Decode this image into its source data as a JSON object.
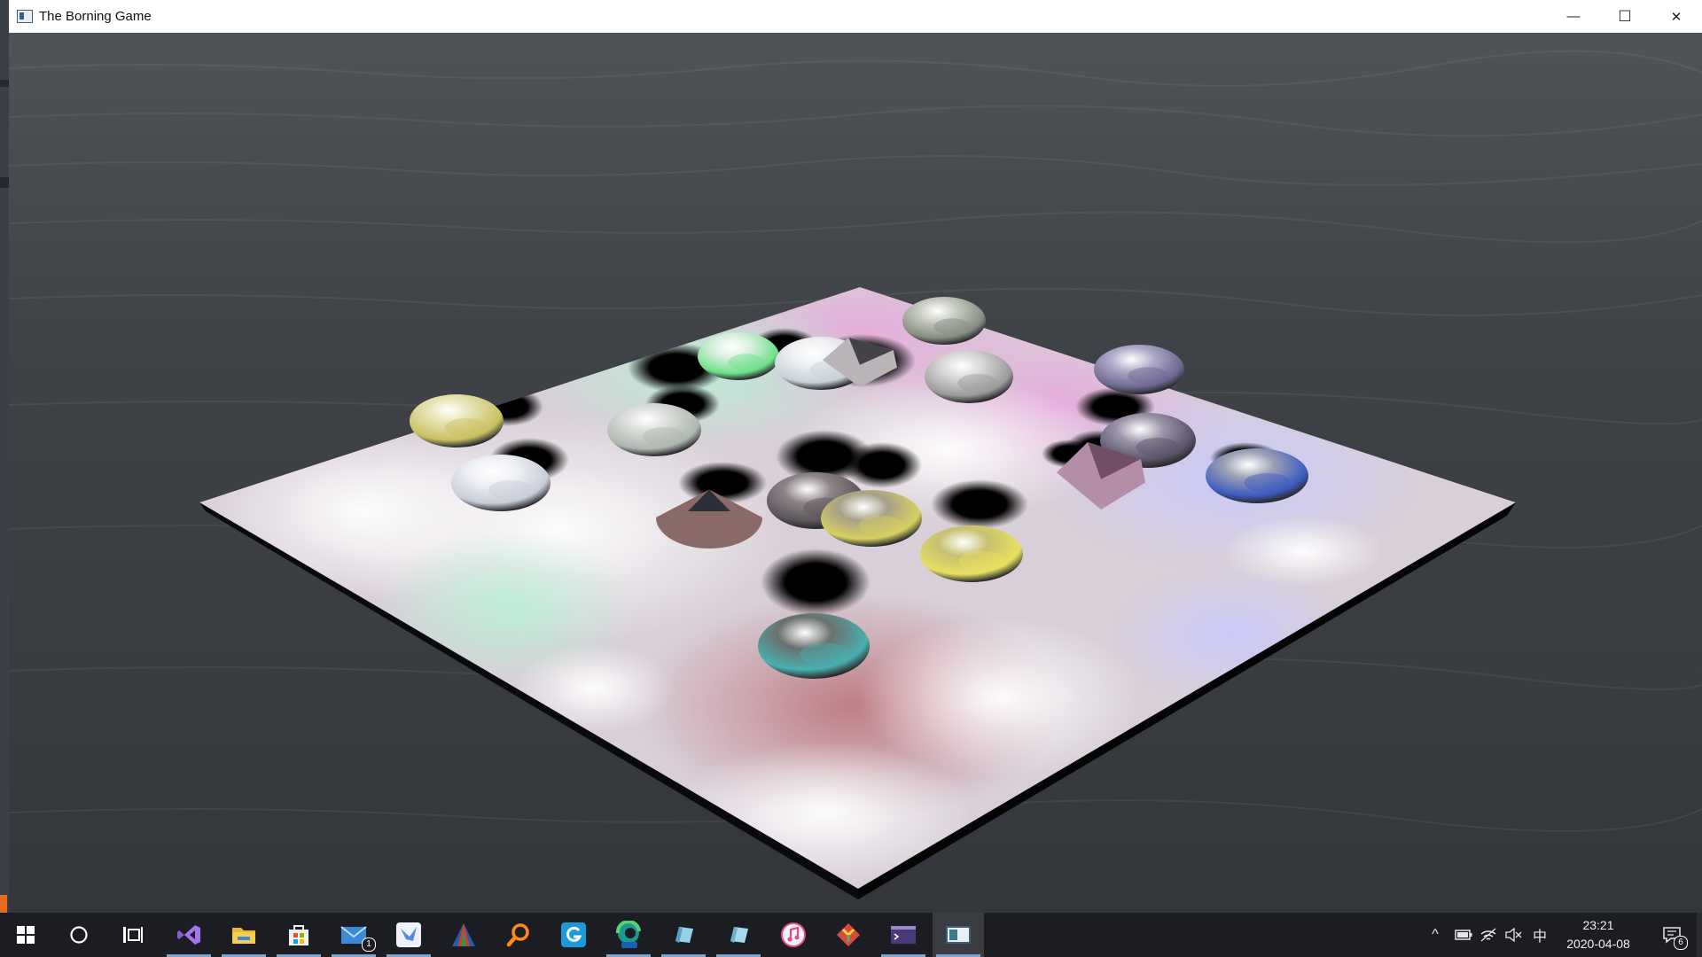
{
  "window": {
    "title": "The Borning Game",
    "controls": {
      "minimize": "—",
      "maximize": "☐",
      "close": "✕"
    }
  },
  "game": {
    "board_color": "#f2e9f0",
    "water_color": "#3a3d42",
    "balls": [
      {
        "kind": "sphere",
        "color": "#e6e2b0",
        "accent": "#c9c060"
      },
      {
        "kind": "sphere",
        "color": "#eef0f4",
        "accent": "#c8ccd8"
      },
      {
        "kind": "sphere",
        "color": "#d9dcd8",
        "accent": "#aeb6b0"
      },
      {
        "kind": "sphere",
        "color": "#d7f0dc",
        "accent": "#6ee08a"
      },
      {
        "kind": "sphere",
        "color": "#eef0f2",
        "accent": "#c8d0d8"
      },
      {
        "kind": "pyramid",
        "color": "#b8b4b8",
        "accent": "#1c1c22"
      },
      {
        "kind": "sphere",
        "color": "#c5c9bf",
        "accent": "#868c80"
      },
      {
        "kind": "sphere",
        "color": "#d8d6d4",
        "accent": "#9a9a9a"
      },
      {
        "kind": "sphere",
        "color": "#aeaac8",
        "accent": "#6c6890"
      },
      {
        "kind": "sphere",
        "color": "#9c94a8",
        "accent": "#5a5268"
      },
      {
        "kind": "pyramid",
        "color": "#b48ea8",
        "accent": "#5a3850"
      },
      {
        "kind": "sphere",
        "color": "#9aa0b4",
        "accent": "#3c5cc0"
      },
      {
        "kind": "cone",
        "color": "#8a6a68",
        "accent": "#2a3038"
      },
      {
        "kind": "sphere",
        "color": "#8e8488",
        "accent": "#5a5458"
      },
      {
        "kind": "sphere",
        "color": "#a8a088",
        "accent": "#d8d060"
      },
      {
        "kind": "sphere",
        "color": "#c8c070",
        "accent": "#e6e060"
      },
      {
        "kind": "sphere",
        "color": "#6a706e",
        "accent": "#4ab0b0"
      }
    ]
  },
  "taskbar": {
    "pinned": [
      {
        "name": "start-button-icon"
      },
      {
        "name": "cortana-search-icon"
      },
      {
        "name": "task-view-icon"
      },
      {
        "name": "visual-studio-icon"
      },
      {
        "name": "file-explorer-icon"
      },
      {
        "name": "microsoft-store-icon"
      },
      {
        "name": "mail-icon",
        "badge": "1"
      },
      {
        "name": "bird-app-icon"
      },
      {
        "name": "vector-app-icon"
      },
      {
        "name": "magnifier-search-icon"
      },
      {
        "name": "g-app-icon"
      },
      {
        "name": "edge-beta-icon"
      },
      {
        "name": "glass-app-icon"
      },
      {
        "name": "glass-app-icon-2"
      },
      {
        "name": "itunes-icon"
      },
      {
        "name": "git-icon"
      },
      {
        "name": "terminal-icon"
      },
      {
        "name": "game-window-icon"
      }
    ],
    "tray": {
      "chevron": "^",
      "ime": "中",
      "time": "23:21",
      "date": "2020-04-08",
      "notification_count": "6"
    }
  }
}
